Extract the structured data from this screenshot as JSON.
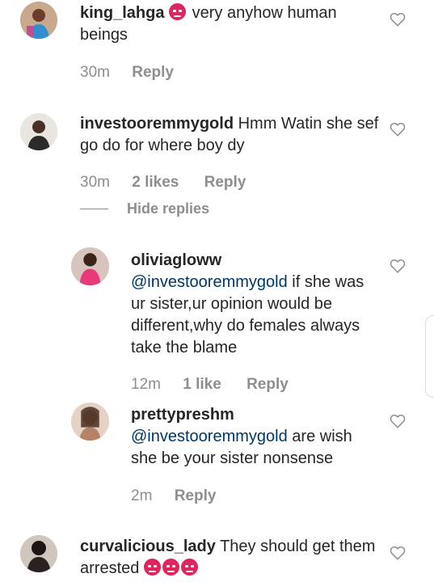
{
  "comments": [
    {
      "username": "king_lahga",
      "text": "very anyhow human beings",
      "emoji_before_text": "angry-face-emoji",
      "time": "30m",
      "reply_label": "Reply"
    },
    {
      "username": "investooremmygold",
      "text": "Hmm Watin she sef go do for where boy dy",
      "time": "30m",
      "likes": "2 likes",
      "reply_label": "Reply",
      "hide_replies_label": "Hide replies",
      "replies": [
        {
          "username": "oliviagloww",
          "mention": "@investooremmygold",
          "text": "if she was ur sister,ur opinion would be different,why do females always take the blame",
          "time": "12m",
          "likes": "1 like",
          "reply_label": "Reply"
        },
        {
          "username": "prettypreshm",
          "mention": "@investooremmygold",
          "text": "are wish she be your sister nonsense",
          "time": "2m",
          "reply_label": "Reply"
        }
      ]
    },
    {
      "username": "curvalicious_lady",
      "text": "They should get them arrested",
      "emoji_after_text": [
        "angry-face-emoji",
        "angry-face-emoji",
        "angry-face-emoji"
      ]
    }
  ],
  "colors": {
    "text": "#262626",
    "meta": "#8e8e8e",
    "mention": "#00376b",
    "emoji": "#e0245e"
  }
}
